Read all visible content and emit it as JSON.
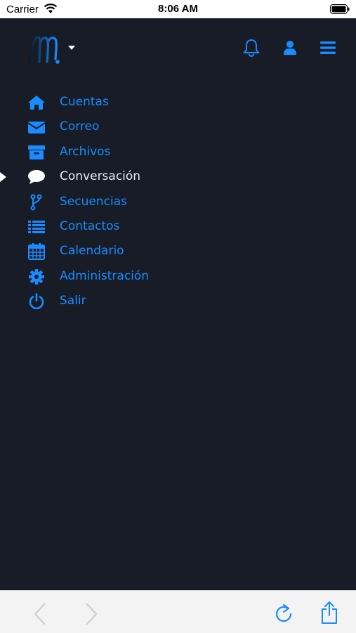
{
  "status_bar": {
    "carrier": "Carrier",
    "time": "8:06 AM"
  },
  "colors": {
    "background": "#171c27",
    "accent": "#1a8cff",
    "active_text": "#e9ecef"
  },
  "header": {
    "logo_icon": "m-logo",
    "dropdown_icon": "caret-down-icon",
    "icons": [
      "bell-icon",
      "user-icon",
      "hamburger-menu-icon"
    ]
  },
  "menu": {
    "items": [
      {
        "label": "Cuentas",
        "icon": "home-icon",
        "active": false
      },
      {
        "label": "Correo",
        "icon": "envelope-icon",
        "active": false
      },
      {
        "label": "Archivos",
        "icon": "archive-icon",
        "active": false
      },
      {
        "label": "Conversación",
        "icon": "chat-bubble-icon",
        "active": true
      },
      {
        "label": "Secuencias",
        "icon": "branch-icon",
        "active": false
      },
      {
        "label": "Contactos",
        "icon": "list-icon",
        "active": false
      },
      {
        "label": "Calendario",
        "icon": "calendar-icon",
        "active": false
      },
      {
        "label": "Administración",
        "icon": "gear-icon",
        "active": false
      },
      {
        "label": "Salir",
        "icon": "power-icon",
        "active": false
      }
    ]
  },
  "toolbar": {
    "icons": [
      "back-icon",
      "forward-icon",
      "reload-icon",
      "share-icon"
    ]
  }
}
